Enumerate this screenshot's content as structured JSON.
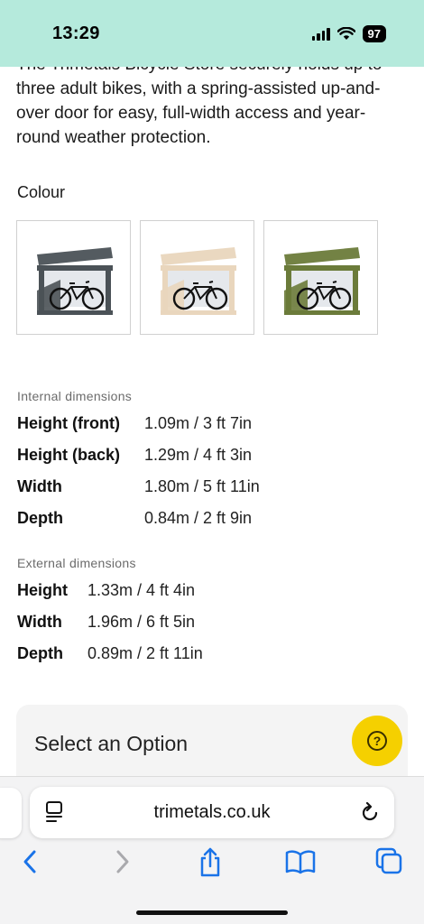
{
  "status_bar": {
    "time": "13:29",
    "battery": "97"
  },
  "product": {
    "intro_text": "The Trimetals Bicycle Store securely holds up to three adult bikes, with a spring-assisted up-and-over door for easy, full-width access and year-round weather protection.",
    "colour_label": "Colour",
    "swatches": [
      {
        "color": "#4b5257",
        "icon": "bike-store-anthracite"
      },
      {
        "color": "#e9d6bd",
        "icon": "bike-store-beige"
      },
      {
        "color": "#6b7b3a",
        "icon": "bike-store-green"
      }
    ]
  },
  "internal": {
    "heading": "Internal dimensions",
    "rows": [
      {
        "label": "Height (front)",
        "value": "1.09m / 3 ft 7in"
      },
      {
        "label": "Height (back)",
        "value": "1.29m / 4 ft 3in"
      },
      {
        "label": "Width",
        "value": "1.80m / 5 ft 11in"
      },
      {
        "label": "Depth",
        "value": "0.84m / 2 ft 9in"
      }
    ]
  },
  "external": {
    "heading": "External dimensions",
    "rows": [
      {
        "label": "Height",
        "value": "1.33m / 4 ft 4in"
      },
      {
        "label": "Width",
        "value": "1.96m / 6 ft 5in"
      },
      {
        "label": "Depth",
        "value": "0.89m / 2 ft 11in"
      }
    ]
  },
  "option_panel": {
    "label": "Select an Option",
    "help_symbol": "?"
  },
  "browser": {
    "url": "trimetals.co.uk",
    "accent": "#1a73e8"
  }
}
